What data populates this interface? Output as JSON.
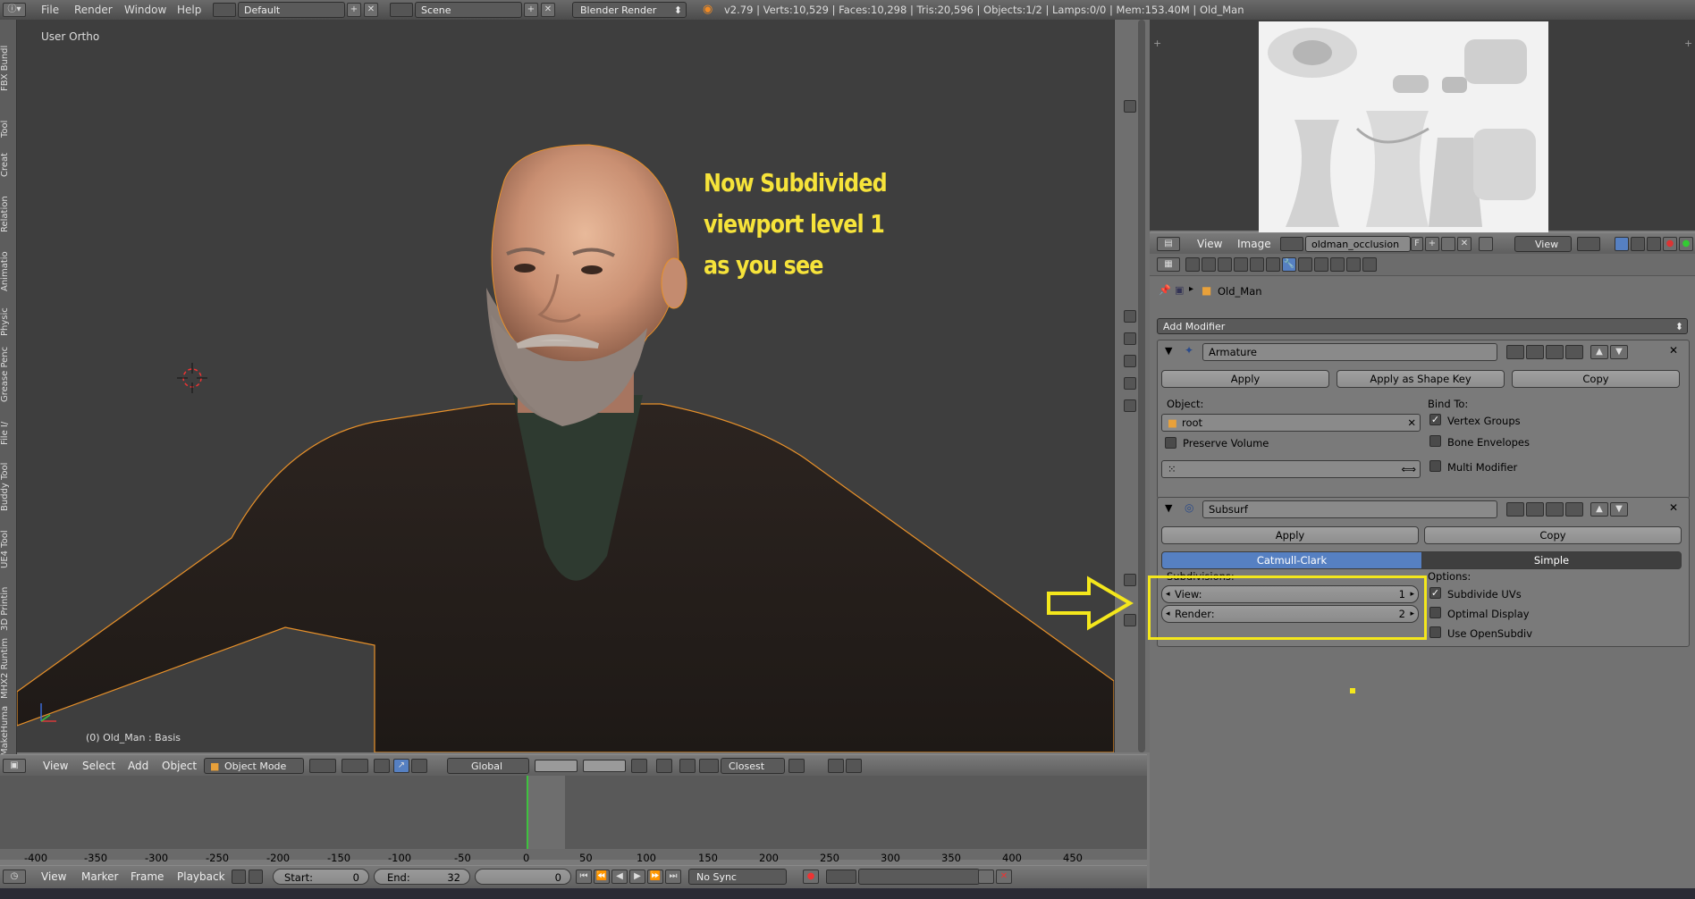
{
  "topbar": {
    "menus": [
      "File",
      "Render",
      "Window",
      "Help"
    ],
    "layout_value": "Default",
    "scene_value": "Scene",
    "engine_value": "Blender Render",
    "stats": "v2.79 | Verts:10,529 | Faces:10,298 | Tris:20,596 | Objects:1/2 | Lamps:0/0 | Mem:153.40M | Old_Man"
  },
  "left_tabs": [
    "FBX Bundl",
    "Tool",
    "Creat",
    "Relation",
    "Animatio",
    "Physic",
    "Grease Penc",
    "File I/",
    "Buddy Tool",
    "UE4 Tool",
    "3D Printin",
    "MHX2 Runtim",
    "MakeHuma"
  ],
  "viewport": {
    "view_label": "User Ortho",
    "object_label": "(0) Old_Man : Basis",
    "annotation": [
      "Now Subdivided",
      "viewport level 1",
      "as you  see"
    ]
  },
  "viewport_header": {
    "menus": [
      "View",
      "Select",
      "Add",
      "Object"
    ],
    "mode": "Object Mode",
    "orientation": "Global",
    "snap": "Closest"
  },
  "image_editor_header": {
    "menus": [
      "View",
      "Image"
    ],
    "image_name": "oldman_occlusion",
    "fake_user": "F",
    "view_select": "View"
  },
  "properties": {
    "breadcrumb": "Old_Man",
    "add_modifier": "Add Modifier",
    "armature": {
      "name": "Armature",
      "apply": "Apply",
      "apply_shape": "Apply as Shape Key",
      "copy": "Copy",
      "object_label": "Object:",
      "object_value": "root",
      "preserve_volume": "Preserve Volume",
      "bind_to": "Bind To:",
      "vertex_groups": "Vertex Groups",
      "bone_envelopes": "Bone Envelopes",
      "multi_modifier": "Multi Modifier"
    },
    "subsurf": {
      "name": "Subsurf",
      "apply": "Apply",
      "copy": "Copy",
      "tab_catmull": "Catmull-Clark",
      "tab_simple": "Simple",
      "subdivisions_label": "Subdivisions:",
      "view_label": "View:",
      "view_value": "1",
      "render_label": "Render:",
      "render_value": "2",
      "options_label": "Options:",
      "subdivide_uvs": "Subdivide UVs",
      "optimal_display": "Optimal Display",
      "use_opensubdiv": "Use OpenSubdiv"
    }
  },
  "timeline": {
    "ticks": [
      "-400",
      "-350",
      "-300",
      "-250",
      "-200",
      "-150",
      "-100",
      "-50",
      "0",
      "50",
      "100",
      "150",
      "200",
      "250",
      "300",
      "350",
      "400",
      "450"
    ]
  },
  "timeline_header": {
    "menus": [
      "View",
      "Marker",
      "Frame",
      "Playback"
    ],
    "start_label": "Start:",
    "start_value": "0",
    "end_label": "End:",
    "end_value": "32",
    "current_value": "0",
    "sync": "No Sync"
  },
  "colors": {
    "annotation_yellow": "#f6e33a",
    "highlight_box": "#f4e71c",
    "active_tab_blue": "#5680c2",
    "playhead_green": "#3ec23e"
  }
}
